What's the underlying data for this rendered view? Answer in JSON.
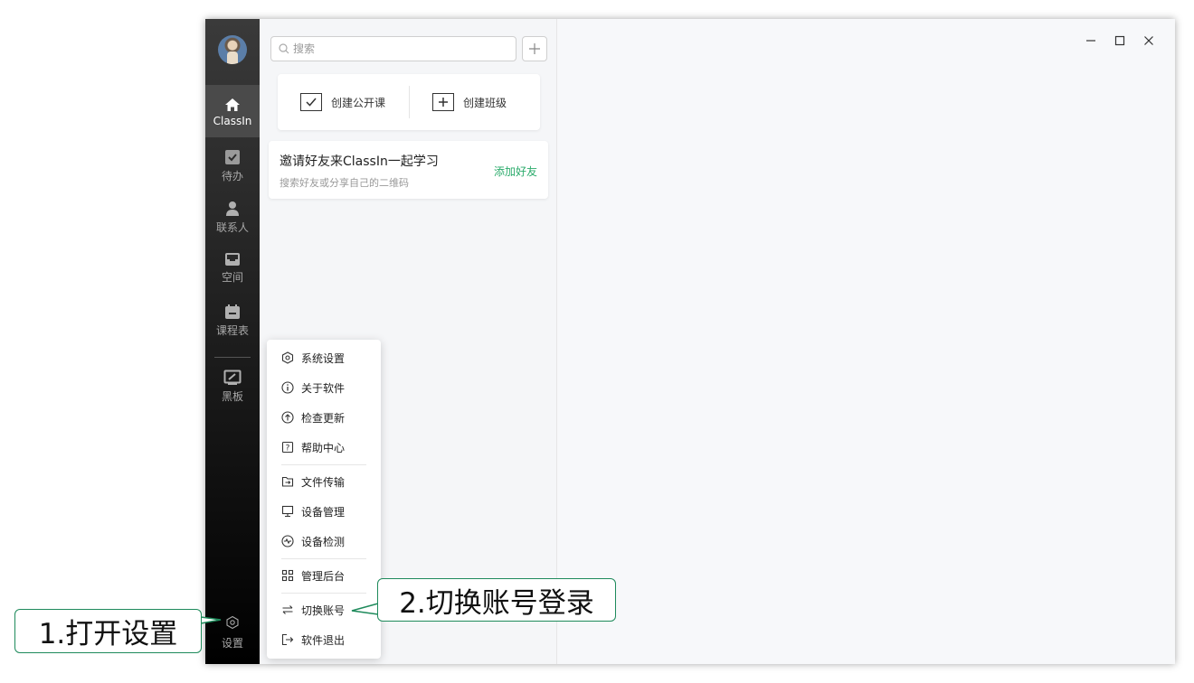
{
  "sidebar": {
    "items": [
      {
        "label": "ClassIn",
        "icon": "home-icon"
      },
      {
        "label": "待办",
        "icon": "checklist-icon"
      },
      {
        "label": "联系人",
        "icon": "person-icon"
      },
      {
        "label": "空间",
        "icon": "inbox-icon"
      },
      {
        "label": "课程表",
        "icon": "calendar-icon"
      },
      {
        "label": "黑板",
        "icon": "blackboard-icon"
      }
    ],
    "settings_label": "设置"
  },
  "search": {
    "placeholder": "搜索"
  },
  "create": {
    "open_class": "创建公开课",
    "create_class": "创建班级"
  },
  "invite": {
    "title": "邀请好友来ClassIn一起学习",
    "subtitle": "搜索好友或分享自己的二维码",
    "action": "添加好友"
  },
  "menu": {
    "items": [
      {
        "label": "系统设置",
        "icon": "gear-icon"
      },
      {
        "label": "关于软件",
        "icon": "info-icon"
      },
      {
        "label": "检查更新",
        "icon": "upload-icon"
      },
      {
        "label": "帮助中心",
        "icon": "help-icon"
      },
      {
        "label": "文件传输",
        "icon": "file-transfer-icon"
      },
      {
        "label": "设备管理",
        "icon": "monitor-icon"
      },
      {
        "label": "设备检测",
        "icon": "pulse-icon"
      },
      {
        "label": "管理后台",
        "icon": "dashboard-icon"
      },
      {
        "label": "切换账号",
        "icon": "switch-icon"
      },
      {
        "label": "软件退出",
        "icon": "logout-icon"
      }
    ]
  },
  "annotations": {
    "step1": "1.打开设置",
    "step2": "2.切换账号登录"
  },
  "colors": {
    "accent": "#2bab6b",
    "callout_border": "#1e8a5b"
  }
}
